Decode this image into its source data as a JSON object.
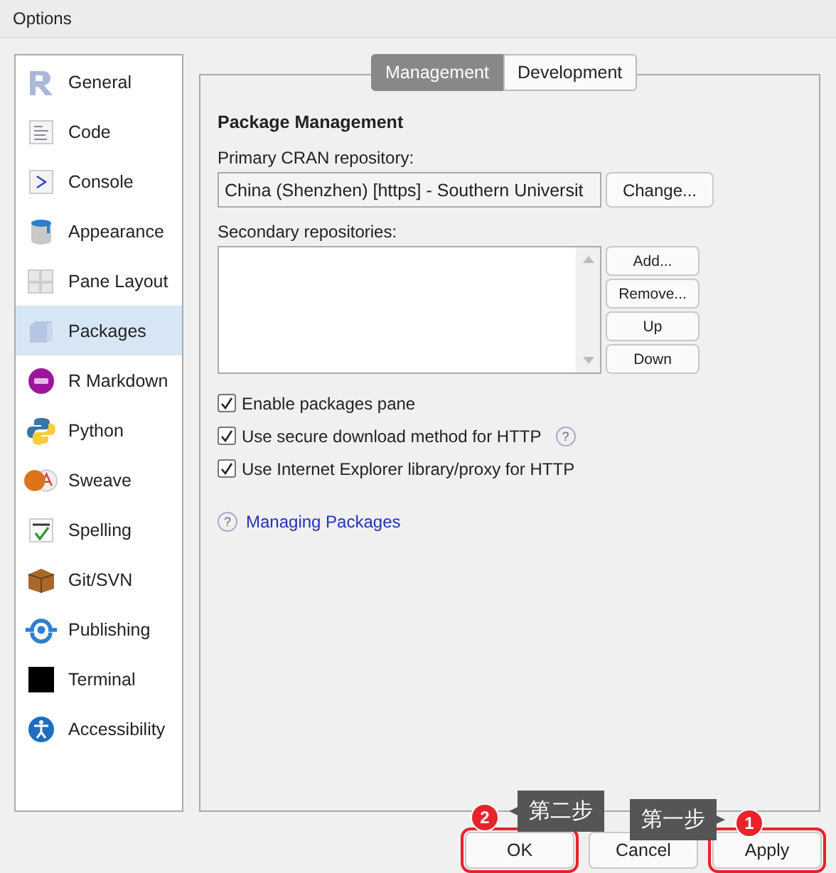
{
  "window": {
    "title": "Options"
  },
  "sidebar": {
    "items": [
      {
        "label": "General",
        "selected": false
      },
      {
        "label": "Code",
        "selected": false
      },
      {
        "label": "Console",
        "selected": false
      },
      {
        "label": "Appearance",
        "selected": false
      },
      {
        "label": "Pane Layout",
        "selected": false
      },
      {
        "label": "Packages",
        "selected": true
      },
      {
        "label": "R Markdown",
        "selected": false
      },
      {
        "label": "Python",
        "selected": false
      },
      {
        "label": "Sweave",
        "selected": false
      },
      {
        "label": "Spelling",
        "selected": false
      },
      {
        "label": "Git/SVN",
        "selected": false
      },
      {
        "label": "Publishing",
        "selected": false
      },
      {
        "label": "Terminal",
        "selected": false
      },
      {
        "label": "Accessibility",
        "selected": false
      }
    ]
  },
  "tabs": [
    {
      "label": "Management",
      "selected": true
    },
    {
      "label": "Development",
      "selected": false
    }
  ],
  "panel": {
    "heading": "Package Management",
    "primary_label": "Primary CRAN repository:",
    "primary_value": "China (Shenzhen) [https] - Southern Universit",
    "change_button": "Change...",
    "secondary_label": "Secondary repositories:",
    "list_buttons": [
      "Add...",
      "Remove...",
      "Up",
      "Down"
    ],
    "checkboxes": [
      {
        "label": "Enable packages pane",
        "checked": true
      },
      {
        "label": "Use secure download method for HTTP",
        "checked": true,
        "help": "?"
      },
      {
        "label": "Use Internet Explorer library/proxy for HTTP",
        "checked": true
      }
    ],
    "help_link": {
      "mark": "?",
      "label": "Managing Packages"
    }
  },
  "dialog_buttons": [
    {
      "label": "OK",
      "marked": true
    },
    {
      "label": "Cancel",
      "marked": false
    },
    {
      "label": "Apply",
      "marked": true
    }
  ],
  "annotations": [
    {
      "number": "2",
      "text": "第二步"
    },
    {
      "number": "1",
      "text": "第一步"
    }
  ]
}
